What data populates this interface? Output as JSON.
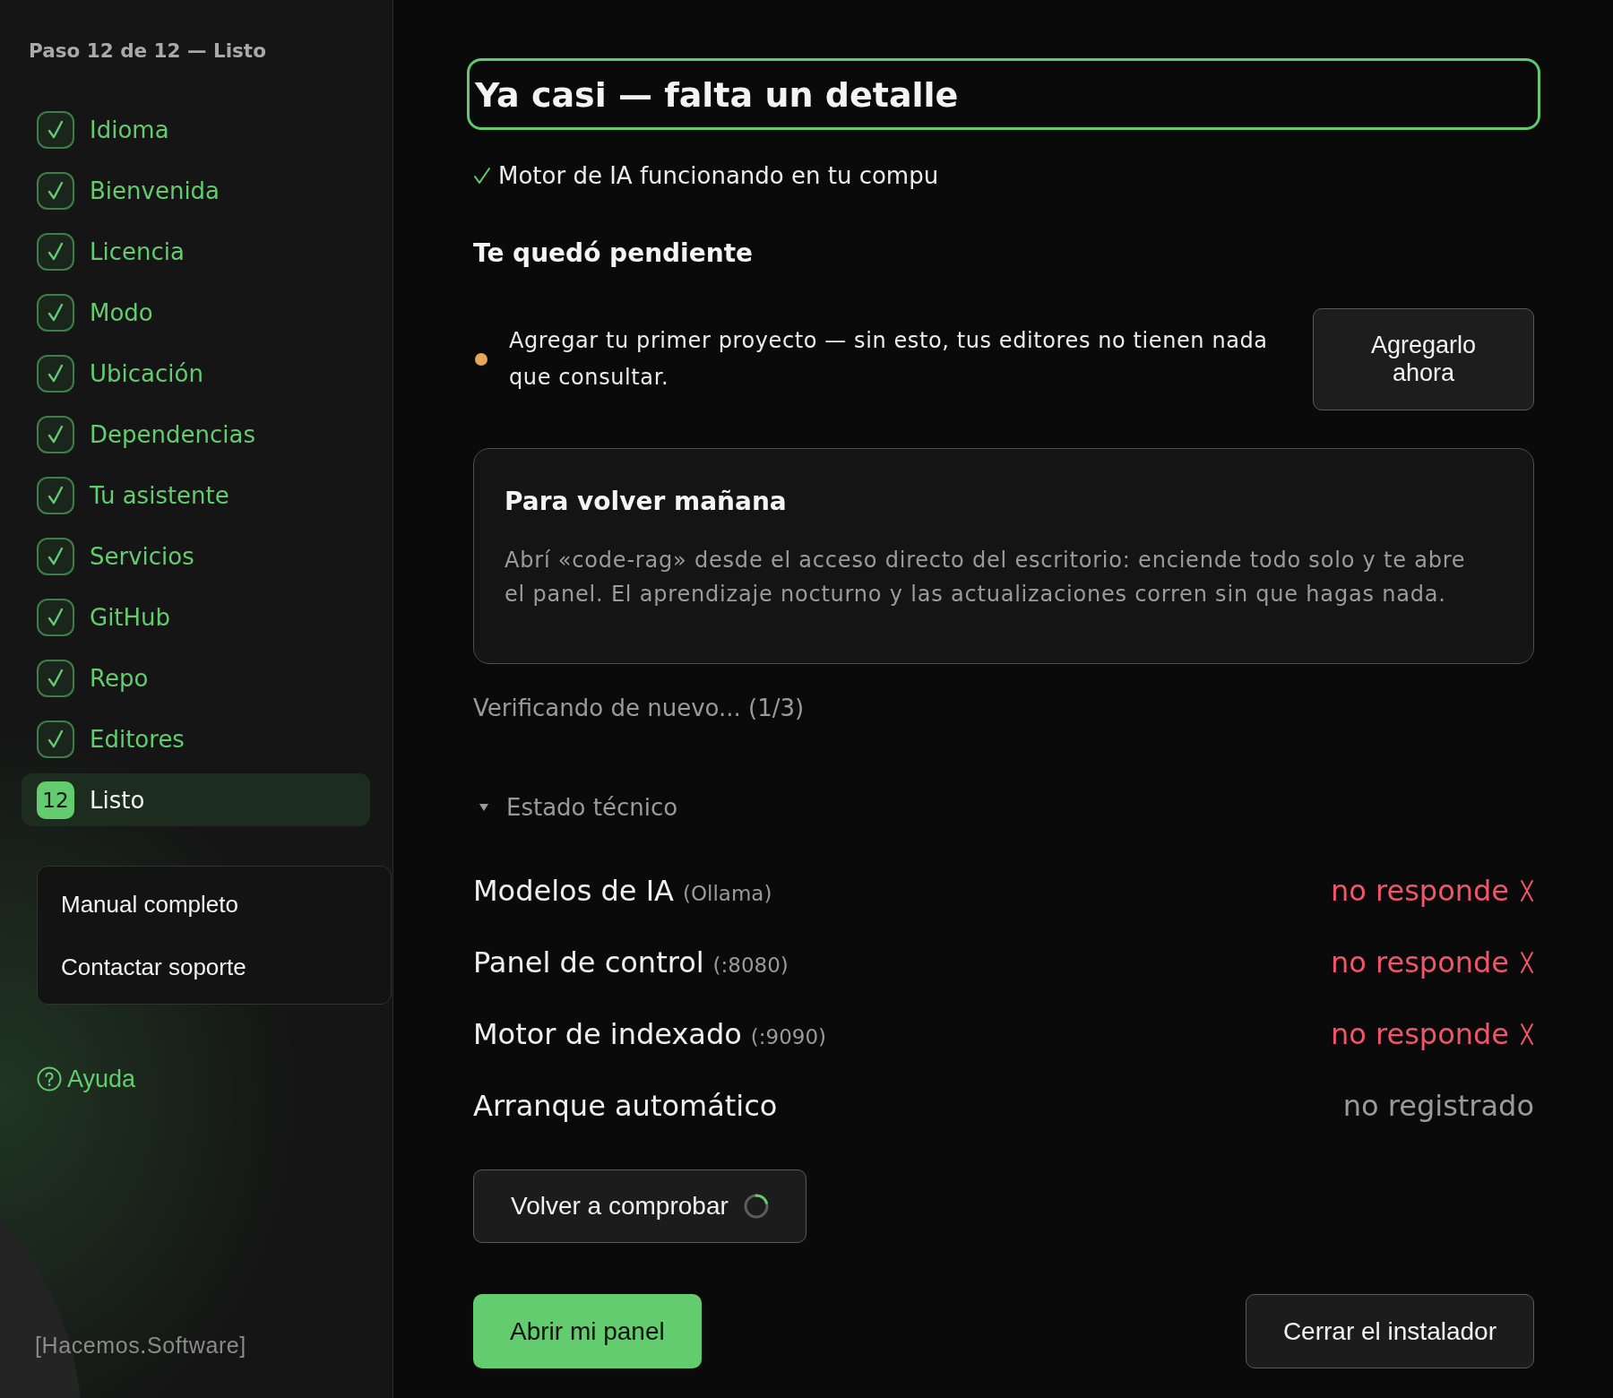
{
  "sidebar": {
    "step_label": "Paso 12 de 12 — Listo",
    "steps": [
      {
        "label": "Idioma",
        "completed": true,
        "selected": false
      },
      {
        "label": "Bienvenida",
        "completed": true,
        "selected": false
      },
      {
        "label": "Licencia",
        "completed": true,
        "selected": false
      },
      {
        "label": "Modo",
        "completed": true,
        "selected": false
      },
      {
        "label": "Ubicación",
        "completed": true,
        "selected": false
      },
      {
        "label": "Dependencias",
        "completed": true,
        "selected": false
      },
      {
        "label": "Tu asistente",
        "completed": true,
        "selected": false
      },
      {
        "label": "Servicios",
        "completed": true,
        "selected": false
      },
      {
        "label": "GitHub",
        "completed": true,
        "selected": false
      },
      {
        "label": "Repo",
        "completed": true,
        "selected": false
      },
      {
        "label": "Editores",
        "completed": true,
        "selected": false
      },
      {
        "label": "Listo",
        "number": "12",
        "completed": false,
        "selected": true
      }
    ],
    "help_menu": [
      "Manual completo",
      "Contactar soporte"
    ],
    "help_link": "Ayuda",
    "brand": [
      {
        "text": "[Hacemos",
        "accent": false
      },
      {
        "text": ".",
        "accent": true
      },
      {
        "text": "Software]",
        "accent": false
      }
    ]
  },
  "main": {
    "title": {
      "text": "Ya casi — falta un detalle",
      "focused": true
    },
    "engine_status": {
      "text": "Motor de IA funcionando en tu compu",
      "ok": true
    },
    "pending_heading": "Te quedó pendiente",
    "pending": [
      {
        "text": "Agregar tu primer proyecto — sin esto, tus editores no tienen nada que consultar.",
        "action": "Agregarlo ahora"
      }
    ],
    "tip_card": {
      "title": "Para volver mañana",
      "body": "Abrí «code-rag» desde el acceso directo del escritorio: enciende todo solo y te abre el panel. El aprendizaje nocturno y las actualizaciones corren sin que hagas nada."
    },
    "recheck_status": "Verificando de nuevo... (1/3)",
    "tech_status": {
      "label": "Estado técnico",
      "expanded": true,
      "rows": [
        {
          "name": "Modelos de IA",
          "detail": "(Ollama)",
          "status": "no responde",
          "error": true
        },
        {
          "name": "Panel de control",
          "detail": "(:8080)",
          "status": "no responde",
          "error": true
        },
        {
          "name": "Motor de indexado",
          "detail": "(:9090)",
          "status": "no responde",
          "error": true
        },
        {
          "name": "Arranque automático",
          "status": "no registrado",
          "error": false
        }
      ]
    },
    "recheck_button": {
      "label": "Volver a comprobar",
      "busy": true
    },
    "actions": [
      {
        "label": "Abrir mi panel",
        "kind": "primary"
      },
      {
        "label": "Cerrar el instalador",
        "kind": "secondary"
      }
    ]
  }
}
